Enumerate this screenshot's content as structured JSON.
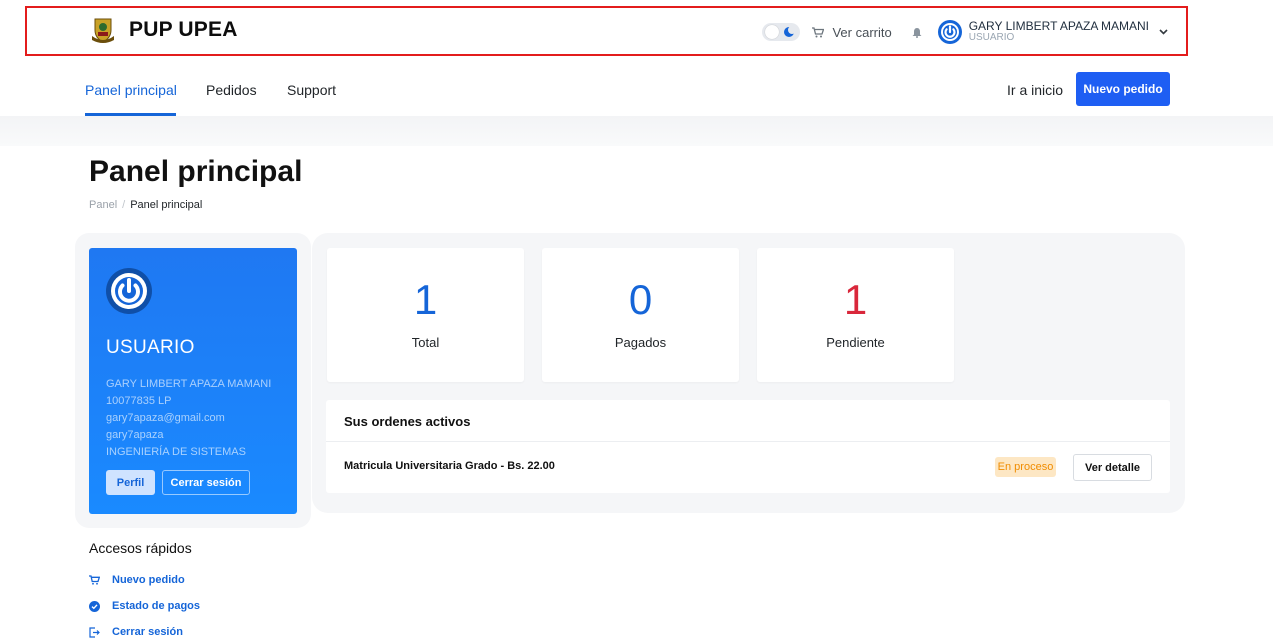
{
  "header": {
    "brand_name": "PUP UPEA",
    "cart_label": "Ver carrito",
    "user_name": "GARY LIMBERT APAZA MAMANI",
    "user_role": "USUARIO"
  },
  "nav": {
    "tabs": [
      {
        "label": "Panel principal",
        "active": true
      },
      {
        "label": "Pedidos",
        "active": false
      },
      {
        "label": "Support",
        "active": false
      }
    ],
    "home_link": "Ir a inicio",
    "new_order_button": "Nuevo pedido"
  },
  "page": {
    "title": "Panel principal",
    "breadcrumb": [
      "Panel",
      "Panel principal"
    ]
  },
  "profile": {
    "role": "USUARIO",
    "lines": [
      "GARY LIMBERT APAZA MAMANI",
      "10077835 LP",
      "gary7apaza@gmail.com",
      "gary7apaza",
      "INGENIERÍA DE SISTEMAS"
    ],
    "profile_button": "Perfil",
    "logout_button": "Cerrar sesión"
  },
  "quick_access": {
    "title": "Accesos rápidos",
    "items": [
      {
        "label": "Nuevo pedido",
        "icon": "cart-icon"
      },
      {
        "label": "Estado de pagos",
        "icon": "check-circle-icon"
      },
      {
        "label": "Cerrar sesión",
        "icon": "logout-icon"
      }
    ]
  },
  "stats": [
    {
      "value": "1",
      "label": "Total",
      "color": "#1565d8"
    },
    {
      "value": "0",
      "label": "Pagados",
      "color": "#1565d8"
    },
    {
      "value": "1",
      "label": "Pendiente",
      "color": "#d9273b"
    }
  ],
  "orders": {
    "title": "Sus ordenes activos",
    "items": [
      {
        "description": "Matricula Universitaria Grado - Bs. 22.00",
        "status": "En proceso",
        "action": "Ver detalle"
      }
    ]
  },
  "colors": {
    "primary": "#1565d8",
    "button_blue": "#1e5ef3",
    "pending_red": "#d9273b",
    "badge_orange": "#f08c00",
    "header_border": "#e31c1c"
  }
}
